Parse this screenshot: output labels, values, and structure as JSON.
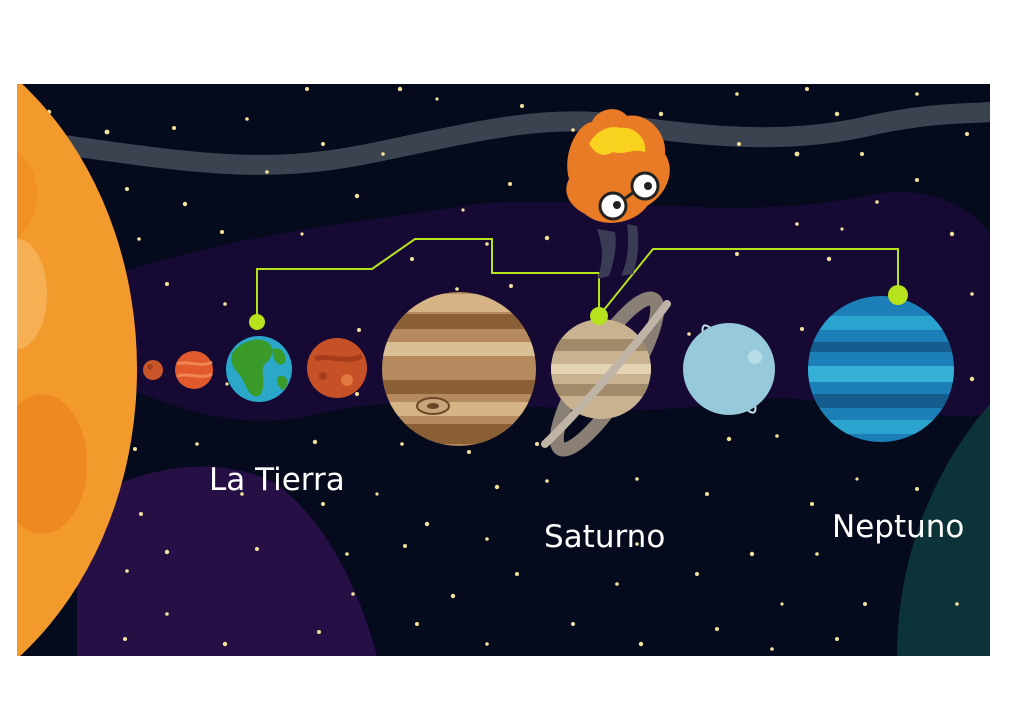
{
  "labels": {
    "earth": "La Tierra",
    "saturn": "Saturno",
    "neptune": "Neptuno"
  },
  "colors": {
    "space": "#050b1d",
    "pointer_line": "#b7e21e",
    "sun": "#f39a2c",
    "label_text": "#ffffff"
  },
  "characters": {
    "mascot": "orange-flame-character-with-glasses"
  }
}
